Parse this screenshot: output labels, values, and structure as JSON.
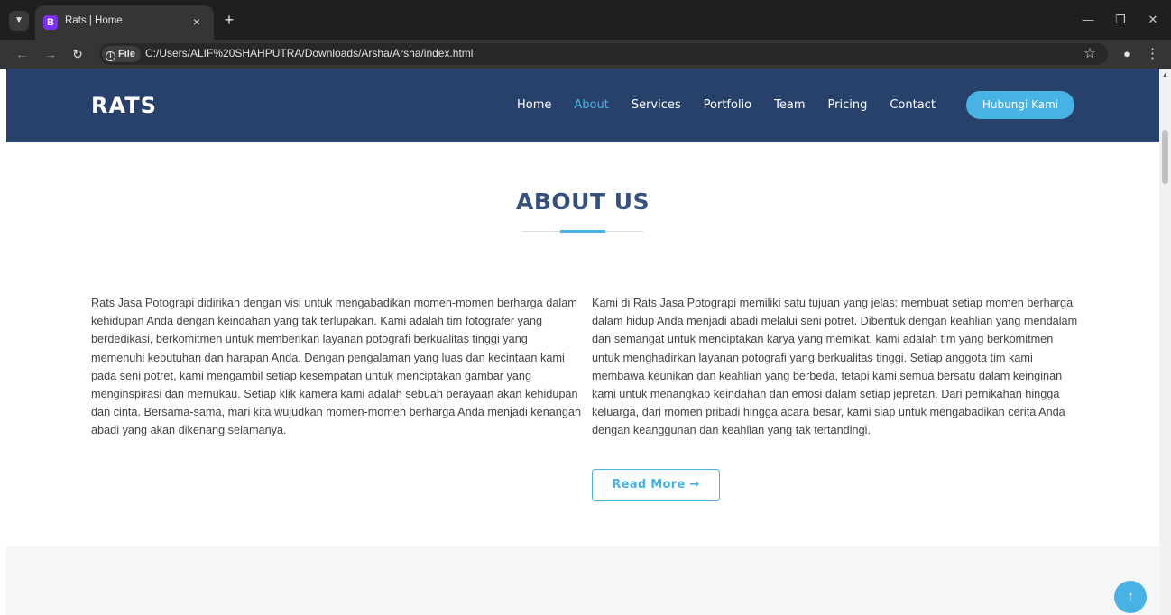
{
  "browser": {
    "tab_title": "Rats | Home",
    "tab_favicon_letter": "B",
    "new_tab_symbol": "+",
    "tab_close_symbol": "×",
    "address_scheme_label": "File",
    "url": "C:/Users/ALIF%20SHAHPUTRA/Downloads/Arsha/Arsha/index.html"
  },
  "site": {
    "logo": "RATS",
    "nav": {
      "home": "Home",
      "about": "About",
      "services": "Services",
      "portfolio": "Portfolio",
      "team": "Team",
      "pricing": "Pricing",
      "contact": "Contact"
    },
    "active_nav": "About",
    "cta_label": "Hubungi Kami",
    "colors": {
      "header_bg": "#28416b",
      "accent": "#47b2e4",
      "title": "#37517e",
      "text": "#444444"
    }
  },
  "about": {
    "title": "ABOUT US",
    "left_paragraph": "Rats Jasa Potograpi didirikan dengan visi untuk mengabadikan momen-momen berharga dalam kehidupan Anda dengan keindahan yang tak terlupakan. Kami adalah tim fotografer yang berdedikasi, berkomitmen untuk memberikan layanan potografi berkualitas tinggi yang memenuhi kebutuhan dan harapan Anda. Dengan pengalaman yang luas dan kecintaan kami pada seni potret, kami mengambil setiap kesempatan untuk menciptakan gambar yang menginspirasi dan memukau. Setiap klik kamera kami adalah sebuah perayaan akan kehidupan dan cinta. Bersama-sama, mari kita wujudkan momen-momen berharga Anda menjadi kenangan abadi yang akan dikenang selamanya.",
    "right_paragraph": "Kami di Rats Jasa Potograpi memiliki satu tujuan yang jelas: membuat setiap momen berharga dalam hidup Anda menjadi abadi melalui seni potret. Dibentuk dengan keahlian yang mendalam dan semangat untuk menciptakan karya yang memikat, kami adalah tim yang berkomitmen untuk menghadirkan layanan potografi yang berkualitas tinggi. Setiap anggota tim kami membawa keunikan dan keahlian yang berbeda, tetapi kami semua bersatu dalam keinginan kami untuk menangkap keindahan dan emosi dalam setiap jepretan. Dari pernikahan hingga keluarga, dari momen pribadi hingga acara besar, kami siap untuk mengabadikan cerita Anda dengan keanggunan dan keahlian yang tak tertandingi.",
    "read_more_label": "Read More →"
  },
  "icons": {
    "tab_menu": "chevron-down-icon",
    "back": "arrow-left-icon",
    "forward": "arrow-right-icon",
    "reload": "reload-icon",
    "info": "info-icon",
    "bookmark": "star-icon",
    "profile": "profile-icon",
    "menu": "kebab-menu-icon",
    "back_to_top": "arrow-up-icon"
  }
}
